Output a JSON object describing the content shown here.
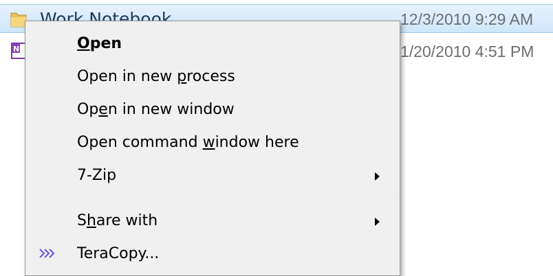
{
  "files": [
    {
      "name": "Work Notebook",
      "date": "12/3/2010 9:29 AM",
      "icon": "folder-icon",
      "selected": true
    },
    {
      "name": "",
      "date": "1/20/2010 4:51 PM",
      "icon": "onenote-icon",
      "selected": false
    }
  ],
  "menu": {
    "items": [
      {
        "pre": "",
        "key": "O",
        "post": "pen",
        "bold": true,
        "submenu": false
      },
      {
        "pre": "Open in new ",
        "key": "p",
        "post": "rocess",
        "bold": false,
        "submenu": false
      },
      {
        "pre": "Op",
        "key": "e",
        "post": "n in new window",
        "bold": false,
        "submenu": false
      },
      {
        "pre": "Open command ",
        "key": "w",
        "post": "indow here",
        "bold": false,
        "submenu": false
      },
      {
        "pre": "7-Zip",
        "key": "",
        "post": "",
        "bold": false,
        "submenu": true
      },
      {
        "pre": "S",
        "key": "h",
        "post": "are with",
        "bold": false,
        "submenu": true
      },
      {
        "pre": "TeraCopy...",
        "key": "",
        "post": "",
        "bold": false,
        "submenu": false,
        "icon": "teracopy-icon"
      }
    ]
  },
  "colors": {
    "selection": "#cfe5fa",
    "menu_bg": "#f0f0f0",
    "teracopy_icon": "#6a4fd8"
  }
}
